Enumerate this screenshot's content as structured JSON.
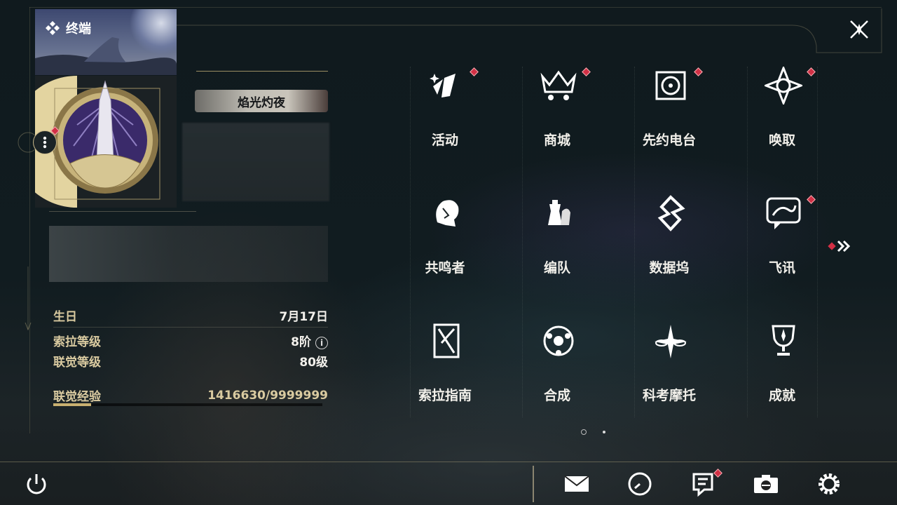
{
  "window": {
    "title": "终端"
  },
  "profile": {
    "title_badge": "焰光灼夜",
    "stats": [
      {
        "key": "生日",
        "value": "7月17日"
      },
      {
        "key": "索拉等级",
        "value": "8阶"
      },
      {
        "key": "联觉等级",
        "value": "80级"
      }
    ],
    "xp": {
      "key": "联觉经验",
      "value": "1416630/9999999",
      "progress": 0.1417
    },
    "info_icon": "i"
  },
  "menu": [
    {
      "label": "活动",
      "icon": "activity-icon",
      "badge": true
    },
    {
      "label": "商城",
      "icon": "shop-crown-icon",
      "badge": true
    },
    {
      "label": "先约电台",
      "icon": "radio-icon",
      "badge": true
    },
    {
      "label": "唤取",
      "icon": "convene-icon",
      "badge": true
    },
    {
      "label": "共鸣者",
      "icon": "resonator-icon",
      "badge": false
    },
    {
      "label": "编队",
      "icon": "chess-team-icon",
      "badge": false
    },
    {
      "label": "数据坞",
      "icon": "data-bank-icon",
      "badge": false
    },
    {
      "label": "飞讯",
      "icon": "message-icon",
      "badge": true
    },
    {
      "label": "索拉指南",
      "icon": "guide-book-icon",
      "badge": false
    },
    {
      "label": "合成",
      "icon": "synthesis-icon",
      "badge": false
    },
    {
      "label": "科考摩托",
      "icon": "motorcycle-icon",
      "badge": false
    },
    {
      "label": "成就",
      "icon": "trophy-icon",
      "badge": false
    }
  ],
  "pager": {
    "current": 1,
    "total": 2
  },
  "bottom_bar": [
    "power-icon",
    "mail-icon",
    "clock-icon",
    "notice-icon",
    "camera-icon",
    "settings-gear-icon"
  ],
  "colors": {
    "accent_gold": "#c9b070",
    "badge_red": "#d23045",
    "text_light": "#f2f0ea"
  }
}
